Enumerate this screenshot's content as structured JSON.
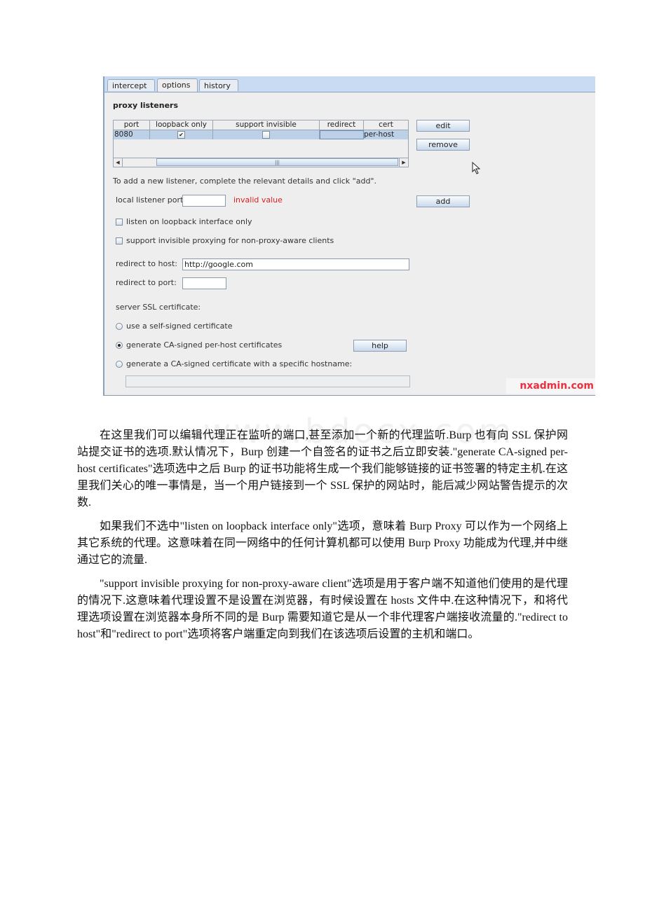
{
  "screenshot": {
    "tabs": [
      {
        "label": "intercept",
        "active": false
      },
      {
        "label": "options",
        "active": true
      },
      {
        "label": "history",
        "active": false
      }
    ],
    "section_title": "proxy listeners",
    "table": {
      "columns": [
        "port",
        "loopback only",
        "support invisible",
        "redirect",
        "cert"
      ],
      "rows": [
        {
          "port": "8080",
          "loopback_only": true,
          "support_invisible": false,
          "redirect": "",
          "cert": "per-host"
        }
      ],
      "scroll_grip": "|||"
    },
    "buttons": {
      "edit": "edit",
      "remove": "remove",
      "add": "add",
      "help": "help"
    },
    "hint": "To add a new listener, complete the relevant details and click \"add\".",
    "local_listener_port": {
      "label": "local listener port:",
      "value": "",
      "error": "invalid value"
    },
    "checkboxes": [
      {
        "label": "listen on loopback interface only",
        "checked": false
      },
      {
        "label": "support invisible proxying for non-proxy-aware clients",
        "checked": false
      }
    ],
    "redirect_host": {
      "label": "redirect to host:",
      "value": "http://google.com"
    },
    "redirect_port": {
      "label": "redirect to port:",
      "value": ""
    },
    "ssl": {
      "label": "server SSL certificate:",
      "options": [
        {
          "label": "use a self-signed certificate",
          "selected": false
        },
        {
          "label": "generate CA-signed per-host certificates",
          "selected": true
        },
        {
          "label": "generate a CA-signed certificate with a specific hostname:",
          "selected": false
        }
      ],
      "hostname_value": ""
    },
    "badge": "nxadmin.com",
    "colors": {
      "error": "#e31b1b",
      "badge": "#f02e3e",
      "tabbar": "#c8dbf2",
      "selection": "#bcd0e8"
    }
  },
  "watermark": "www.bdocx.com",
  "article": {
    "paragraphs": [
      "在这里我们可以编辑代理正在监听的端口,甚至添加一个新的代理监听.Burp 也有向 SSL 保护网站提交证书的选项.默认情况下，Burp 创建一个自签名的证书之后立即安装.\"generate CA-signed per-host certificates\"选项选中之后 Burp 的证书功能将生成一个我们能够链接的证书签署的特定主机.在这里我们关心的唯一事情是，当一个用户链接到一个 SSL 保护的网站时，能后减少网站警告提示的次数.",
      "如果我们不选中\"listen on loopback interface only\"选项，意味着 Burp Proxy 可以作为一个网络上其它系统的代理。这意味着在同一网络中的任何计算机都可以使用 Burp Proxy 功能成为代理,并中继通过它的流量.",
      "\"support invisible proxying for non-proxy-aware client\"选项是用于客户端不知道他们使用的是代理的情况下.这意味着代理设置不是设置在浏览器，有时候设置在 hosts 文件中.在这种情况下，和将代理选项设置在浏览器本身所不同的是 Burp 需要知道它是从一个非代理客户端接收流量的.\"redirect to host\"和\"redirect to port\"选项将客户端重定向到我们在该选项后设置的主机和端口。"
    ]
  }
}
